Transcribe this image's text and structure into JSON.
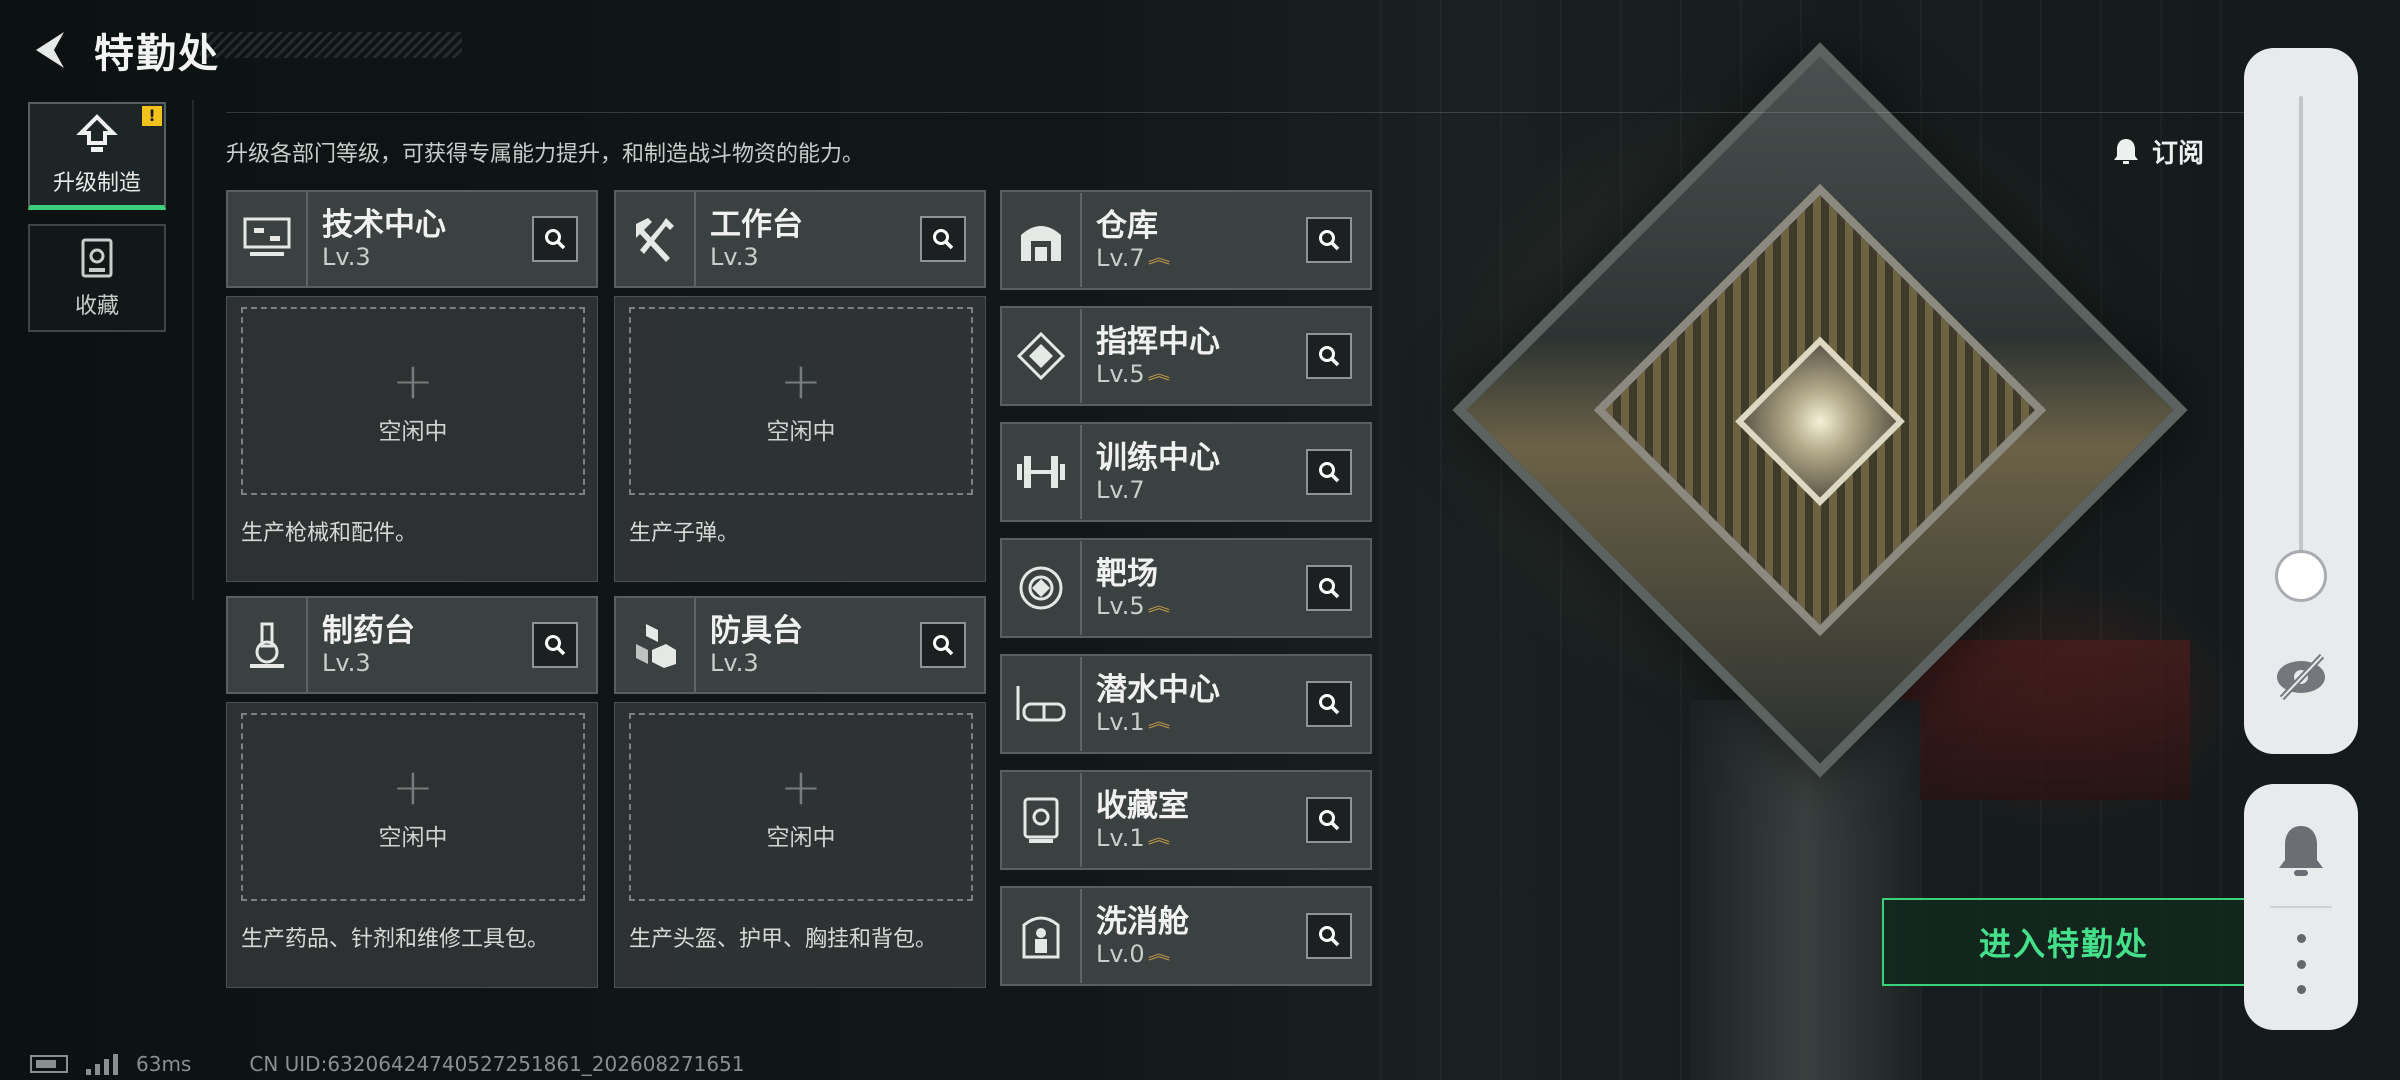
{
  "header": {
    "title": "特勤处",
    "back_icon": "back-arrow-icon"
  },
  "tabs": [
    {
      "label": "升级制造",
      "icon": "upgrade-icon",
      "active": true,
      "alert": "!"
    },
    {
      "label": "收藏",
      "icon": "collection-icon",
      "active": false
    }
  ],
  "subtitle": "升级各部门等级，可获得专属能力提升，和制造战斗物资的能力。",
  "subscribe_label": "订阅",
  "production_cards": [
    {
      "name": "技术中心",
      "level": "Lv.3",
      "icon": "monitor-icon",
      "slot": "空闲中",
      "desc": "生产枪械和配件。"
    },
    {
      "name": "工作台",
      "level": "Lv.3",
      "icon": "tools-icon",
      "slot": "空闲中",
      "desc": "生产子弹。"
    },
    {
      "name": "制药台",
      "level": "Lv.3",
      "icon": "microscope-icon",
      "slot": "空闲中",
      "desc": "生产药品、针剂和维修工具包。"
    },
    {
      "name": "防具台",
      "level": "Lv.3",
      "icon": "armor-boxes-icon",
      "slot": "空闲中",
      "desc": "生产头盔、护甲、胸挂和背包。"
    }
  ],
  "facilities": [
    {
      "name": "仓库",
      "level": "Lv.7",
      "icon": "warehouse-icon",
      "upgradable": true
    },
    {
      "name": "指挥中心",
      "level": "Lv.5",
      "icon": "command-center-icon",
      "upgradable": true
    },
    {
      "name": "训练中心",
      "level": "Lv.7",
      "icon": "dumbbell-icon",
      "upgradable": false
    },
    {
      "name": "靶场",
      "level": "Lv.5",
      "icon": "target-icon",
      "upgradable": true
    },
    {
      "name": "潜水中心",
      "level": "Lv.1",
      "icon": "diving-mask-icon",
      "upgradable": true
    },
    {
      "name": "收藏室",
      "level": "Lv.1",
      "icon": "display-case-icon",
      "upgradable": true
    },
    {
      "name": "洗消舱",
      "level": "Lv.0",
      "icon": "decontamination-icon",
      "upgradable": true
    }
  ],
  "enter_button": "进入特勤处",
  "footer": {
    "ping": "63ms",
    "uid": "CN UID:6320642474052725186​1_202608271651"
  },
  "colors": {
    "accent_green": "#3bd17a",
    "alert_yellow": "#f3c21c",
    "upgrade_chevron": "#c8a04a"
  }
}
